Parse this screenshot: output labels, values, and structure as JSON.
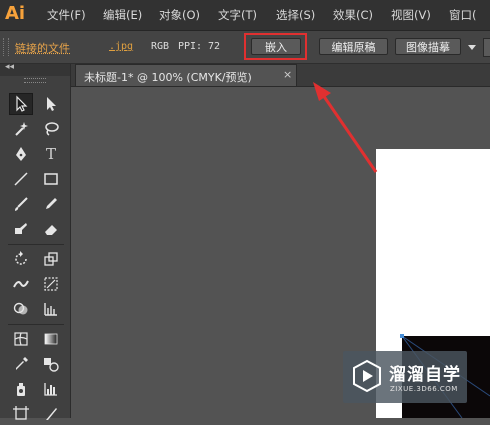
{
  "app": {
    "logo_text": "Ai"
  },
  "menu": [
    "文件(F)",
    "编辑(E)",
    "对象(O)",
    "文字(T)",
    "选择(S)",
    "效果(C)",
    "视图(V)",
    "窗口("
  ],
  "control_bar": {
    "linked_file_label": "链接的文件",
    "file_ext": ".jpg",
    "color_mode": "RGB",
    "ppi_label": "PPI:",
    "ppi_value": "72",
    "embed_button": "嵌入",
    "edit_original_button": "编辑原稿",
    "image_trace_button": "图像描摹"
  },
  "tools": [
    {
      "name": "selection-tool-icon"
    },
    {
      "name": "direct-selection-tool-icon"
    },
    {
      "name": "magic-wand-tool-icon"
    },
    {
      "name": "lasso-tool-icon"
    },
    {
      "name": "pen-tool-icon"
    },
    {
      "name": "type-tool-icon",
      "glyph": "T"
    },
    {
      "name": "line-segment-tool-icon"
    },
    {
      "name": "rectangle-tool-icon"
    },
    {
      "name": "paintbrush-tool-icon"
    },
    {
      "name": "pencil-tool-icon"
    },
    {
      "name": "blob-brush-tool-icon"
    },
    {
      "name": "eraser-tool-icon"
    },
    {
      "name": "rotate-tool-icon"
    },
    {
      "name": "scale-tool-icon"
    },
    {
      "name": "width-tool-icon"
    },
    {
      "name": "free-transform-tool-icon"
    },
    {
      "name": "shape-builder-tool-icon"
    },
    {
      "name": "perspective-grid-tool-icon"
    },
    {
      "name": "mesh-tool-icon"
    },
    {
      "name": "gradient-tool-icon"
    },
    {
      "name": "eyedropper-tool-icon"
    },
    {
      "name": "blend-tool-icon"
    },
    {
      "name": "symbol-sprayer-tool-icon"
    },
    {
      "name": "column-graph-tool-icon"
    },
    {
      "name": "artboard-tool-icon"
    },
    {
      "name": "slice-tool-icon"
    }
  ],
  "document_tab": {
    "title": "未标题-1* @ 100% (CMYK/预览)",
    "close_glyph": "×"
  },
  "watermark": {
    "title": "溜溜自学",
    "url": "ZIXUE.3D66.COM"
  },
  "colors": {
    "accent_orange": "#f7a23b",
    "highlight_red": "#e03030",
    "canvas_bg": "#535353"
  }
}
